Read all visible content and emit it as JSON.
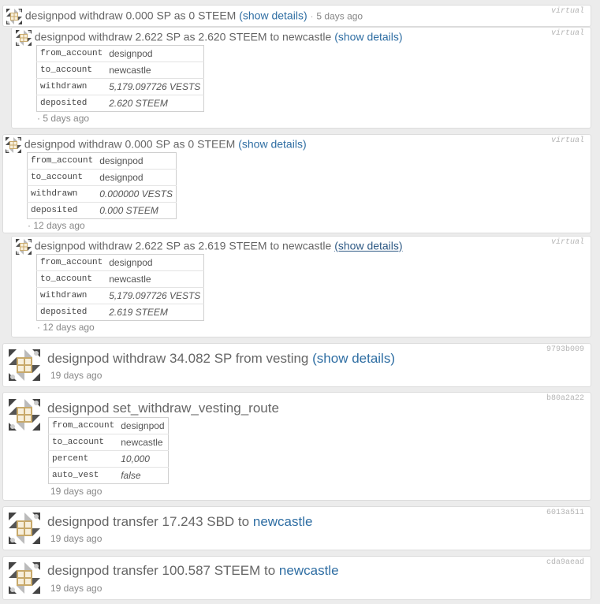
{
  "show_details": "(show details)",
  "ops": [
    {
      "tag": "virtual",
      "parts": [
        "designpod withdraw 0.000 SP as 0 STEEM"
      ],
      "time": "5 days ago"
    },
    {
      "tag": "virtual",
      "parts": [
        "designpod withdraw 2.622 SP as 2.620 STEEM to newcastle"
      ],
      "details": [
        {
          "key": "from_account",
          "value": "designpod"
        },
        {
          "key": "to_account",
          "value": "newcastle"
        },
        {
          "key": "withdrawn",
          "value": "5,179.097726 VESTS"
        },
        {
          "key": "deposited",
          "value": "2.620 STEEM"
        }
      ],
      "time": "5 days ago"
    },
    {
      "tag": "virtual",
      "parts": [
        "designpod withdraw 0.000 SP as 0 STEEM"
      ],
      "details": [
        {
          "key": "from_account",
          "value": "designpod"
        },
        {
          "key": "to_account",
          "value": "designpod"
        },
        {
          "key": "withdrawn",
          "value": "0.000000 VESTS"
        },
        {
          "key": "deposited",
          "value": "0.000 STEEM"
        }
      ],
      "time": "12 days ago"
    },
    {
      "tag": "virtual",
      "parts": [
        "designpod withdraw 2.622 SP as 2.619 STEEM to newcastle"
      ],
      "details": [
        {
          "key": "from_account",
          "value": "designpod"
        },
        {
          "key": "to_account",
          "value": "newcastle"
        },
        {
          "key": "withdrawn",
          "value": "5,179.097726 VESTS"
        },
        {
          "key": "deposited",
          "value": "2.619 STEEM"
        }
      ],
      "time": "12 days ago"
    },
    {
      "tag": "9793b009",
      "parts": [
        "designpod withdraw 34.082 SP from vesting"
      ],
      "time": "19 days ago"
    },
    {
      "tag": "b80a2a22",
      "parts": [
        "designpod set_withdraw_vesting_route"
      ],
      "details": [
        {
          "key": "from_account",
          "value": "designpod"
        },
        {
          "key": "to_account",
          "value": "newcastle"
        },
        {
          "key": "percent",
          "value": "10,000"
        },
        {
          "key": "auto_vest",
          "value": "false"
        }
      ],
      "time": "19 days ago"
    },
    {
      "tag": "6013a511",
      "parts": [
        "designpod transfer 17.243 SBD to"
      ],
      "link": "newcastle",
      "time": "19 days ago"
    },
    {
      "tag": "cda9aead",
      "parts": [
        "designpod transfer 100.587 STEEM to"
      ],
      "link": "newcastle",
      "time": "19 days ago"
    }
  ]
}
